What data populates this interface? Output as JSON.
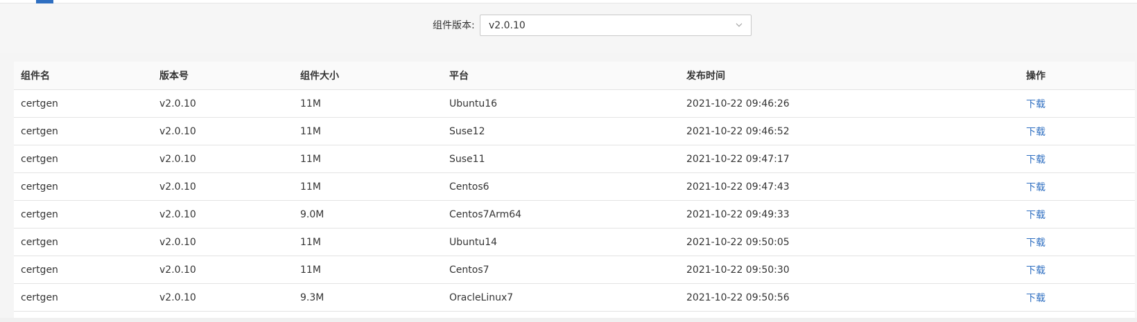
{
  "filter": {
    "label": "组件版本:",
    "selected": "v2.0.10"
  },
  "table": {
    "headers": [
      "组件名",
      "版本号",
      "组件大小",
      "平台",
      "发布时间",
      "操作"
    ],
    "rows": [
      {
        "name": "certgen",
        "version": "v2.0.10",
        "size": "11M",
        "platform": "Ubuntu16",
        "time": "2021-10-22 09:46:26",
        "action": "下载"
      },
      {
        "name": "certgen",
        "version": "v2.0.10",
        "size": "11M",
        "platform": "Suse12",
        "time": "2021-10-22 09:46:52",
        "action": "下载"
      },
      {
        "name": "certgen",
        "version": "v2.0.10",
        "size": "11M",
        "platform": "Suse11",
        "time": "2021-10-22 09:47:17",
        "action": "下载"
      },
      {
        "name": "certgen",
        "version": "v2.0.10",
        "size": "11M",
        "platform": "Centos6",
        "time": "2021-10-22 09:47:43",
        "action": "下载"
      },
      {
        "name": "certgen",
        "version": "v2.0.10",
        "size": "9.0M",
        "platform": "Centos7Arm64",
        "time": "2021-10-22 09:49:33",
        "action": "下载"
      },
      {
        "name": "certgen",
        "version": "v2.0.10",
        "size": "11M",
        "platform": "Ubuntu14",
        "time": "2021-10-22 09:50:05",
        "action": "下载"
      },
      {
        "name": "certgen",
        "version": "v2.0.10",
        "size": "11M",
        "platform": "Centos7",
        "time": "2021-10-22 09:50:30",
        "action": "下载"
      },
      {
        "name": "certgen",
        "version": "v2.0.10",
        "size": "9.3M",
        "platform": "OracleLinux7",
        "time": "2021-10-22 09:50:56",
        "action": "下载"
      }
    ]
  },
  "colors": {
    "accent": "#2f6fc1",
    "border": "#e3e3e3",
    "background": "#f6f6f6"
  },
  "icons": {
    "dropdown": "chevron-down-icon"
  }
}
